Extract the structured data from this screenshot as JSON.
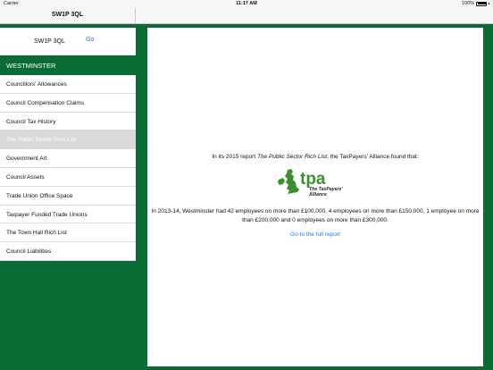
{
  "status_bar": {
    "carrier": "Carrier",
    "time": "11:17 AM",
    "battery": "100%"
  },
  "navbar": {
    "title": "SW1P 3QL"
  },
  "search": {
    "value": "SW1P 3QL",
    "go_label": "Go"
  },
  "sidebar": {
    "section_title": "WESTMINSTER",
    "items": [
      {
        "label": "Councillors' Allowances"
      },
      {
        "label": "Council Compensation Claims"
      },
      {
        "label": "Council Tax History"
      },
      {
        "label": "The Public Sector Rich List"
      },
      {
        "label": "Government Art"
      },
      {
        "label": "Council Assets"
      },
      {
        "label": "Trade Union Office Space"
      },
      {
        "label": "Taxpayer Funded Trade Unions"
      },
      {
        "label": "The Town Hall Rich List"
      },
      {
        "label": "Council Liabilities"
      }
    ],
    "selected_index": 3
  },
  "content": {
    "intro_prefix": "In its 2015 report ",
    "intro_report": "The Public Sector Rich List",
    "intro_suffix": ", the TaxPayers' Alliance found that:",
    "logo": {
      "acronym": "tpa",
      "line1": "The TaxPayers'",
      "line2": "Alliance"
    },
    "body": "In 2013-14, Westminster had 42 employees on more than £100,000, 4 employees on more than £150,000, 1 employee on more than £200,000 and 0 employees on more than £300,000.",
    "link_label": "Go to the full report"
  },
  "colors": {
    "brand_green": "#0b6b34",
    "link_blue": "#1b7cf2",
    "selected_gray": "#d9d9d9"
  }
}
